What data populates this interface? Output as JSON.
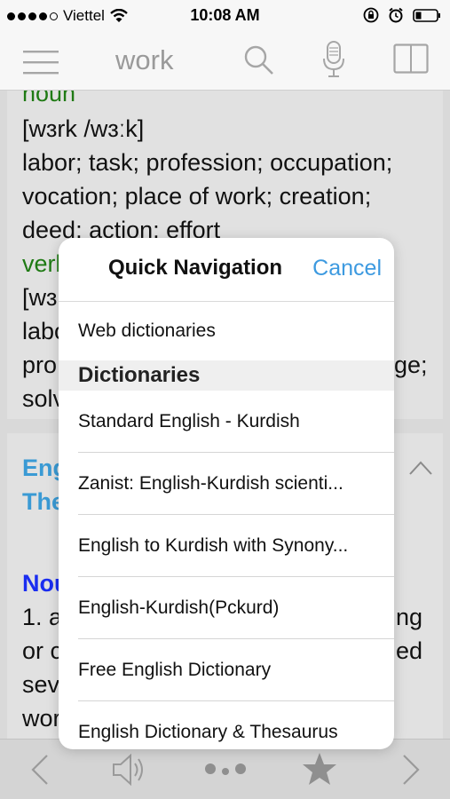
{
  "status_bar": {
    "carrier": "Viettel",
    "time": "10:08 AM"
  },
  "toolbar": {
    "search_word": "work",
    "icons": [
      "menu-icon",
      "search-icon",
      "microphone-icon",
      "book-icon"
    ]
  },
  "entry1": {
    "pos_noun": "noun",
    "pron": "[wɜrk /wɜːk]",
    "def1": "labor; task; profession; occupation;",
    "def2": "vocation; place of work; creation;",
    "def3": "deed; action; effort",
    "pos_verb": "verb",
    "pron2": "[wɜ",
    "labo": "labo",
    "pro": "pro",
    "ge": "ge;",
    "solv": "solv"
  },
  "entry2": {
    "heading1": "Eng",
    "heading2": "The",
    "noun": "Nou",
    "l1": "1. a",
    "l1r": "ng",
    "l2": "or c",
    "l2r": "ed",
    "l3": "sev",
    "l4": "wor"
  },
  "popover": {
    "title": "Quick Navigation",
    "cancel": "Cancel",
    "web_item": "Web dictionaries",
    "section": "Dictionaries",
    "items": [
      "Standard  English - Kurdish",
      "Zanist: English-Kurdish scienti...",
      "English to Kurdish with Synony...",
      "English-Kurdish(Pckurd)",
      "Free English Dictionary",
      "English Dictionary & Thesaurus"
    ]
  },
  "bottom_bar": {
    "icons": [
      "back-icon",
      "speaker-icon",
      "more-icon",
      "star-icon",
      "forward-icon"
    ]
  },
  "colors": {
    "accent": "#3d9ae0",
    "green": "#1f7a14",
    "blue_heading": "#3a9ad4",
    "noun_blue": "#1a2df0"
  }
}
